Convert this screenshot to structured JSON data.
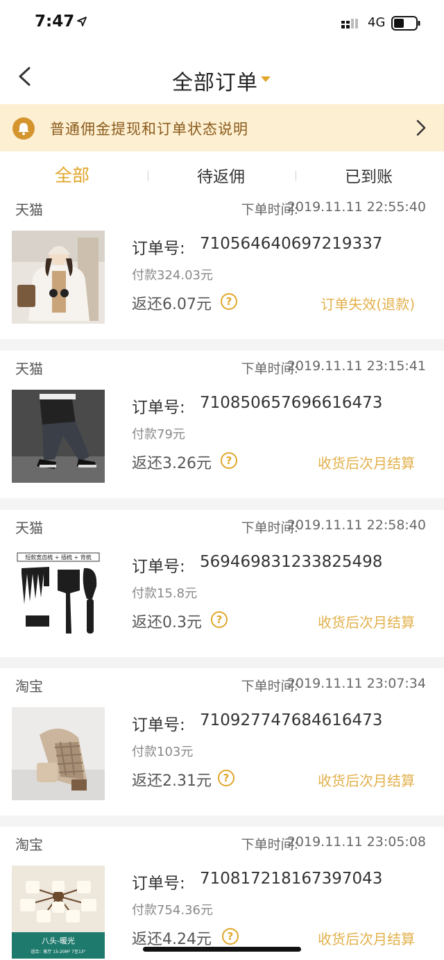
{
  "status_bar": {
    "time": "7:47",
    "network": "4G"
  },
  "nav": {
    "title": "全部订单"
  },
  "notice": {
    "text": "普通佣金提现和订单状态说明"
  },
  "tabs": [
    {
      "label": "全部"
    },
    {
      "label": "待返佣"
    },
    {
      "label": "已到账"
    }
  ],
  "labels": {
    "order_time_label": "下单时间:",
    "order_no_label": "订单号:",
    "help": "?"
  },
  "orders": [
    {
      "shop": "天猫",
      "time": "2019.11.11 22:55:40",
      "order_no": "710564640697219337",
      "paid": "付款324.03元",
      "rebate": "返还6.07元",
      "status": "订单失效(退款)"
    },
    {
      "shop": "天猫",
      "time": "2019.11.11 23:15:41",
      "order_no": "710850657696616473",
      "paid": "付款79元",
      "rebate": "返还3.26元",
      "status": "收货后次月结算"
    },
    {
      "shop": "天猫",
      "time": "2019.11.11 22:58:40",
      "order_no": "569469831233825498",
      "paid": "付款15.8元",
      "rebate": "返还0.3元",
      "status": "收货后次月结算"
    },
    {
      "shop": "淘宝",
      "time": "2019.11.11 23:07:34",
      "order_no": "710927747684616473",
      "paid": "付款103元",
      "rebate": "返还2.31元",
      "status": "收货后次月结算"
    },
    {
      "shop": "淘宝",
      "time": "2019.11.11 23:05:08",
      "order_no": "710817218167397043",
      "paid": "付款754.36元",
      "rebate": "返还4.24元",
      "status": "收货后次月结算"
    }
  ],
  "thumb_captions": {
    "comb": "短款宽齿梳 + 插梳 + 背梳",
    "lamp_title": "八头-暖光",
    "lamp_sub": "适合：客厅 15-20M²   7至13°"
  },
  "colors": {
    "accent": "#e0a628",
    "notice_bg": "#fdf0d2",
    "status_text": "#e2b04a"
  }
}
